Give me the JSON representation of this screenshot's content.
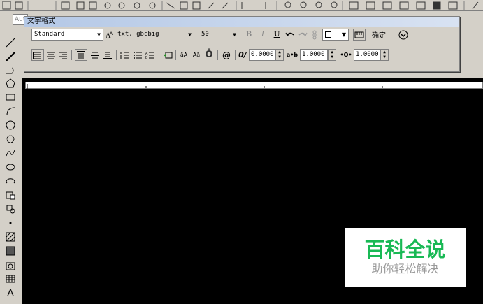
{
  "layer_field": {
    "value": "Aut"
  },
  "text_format": {
    "title": "文字格式",
    "style_value": "Standard",
    "font_value": "txt, gbcbig",
    "height_value": "50",
    "bold": "B",
    "italic": "I",
    "underline": "U",
    "ok_label": "确定",
    "upper_label": "āA",
    "lower_label": "Aā",
    "overline": "Ō",
    "symbol": "@",
    "oblique_icon": "0/",
    "oblique_value": "0.0000",
    "tracking_icon": "a•b",
    "tracking_value": "1.0000",
    "width_icon": "•O•",
    "width_value": "1.0000"
  },
  "watermark": {
    "title": "百科全说",
    "subtitle": "助你轻松解决"
  }
}
